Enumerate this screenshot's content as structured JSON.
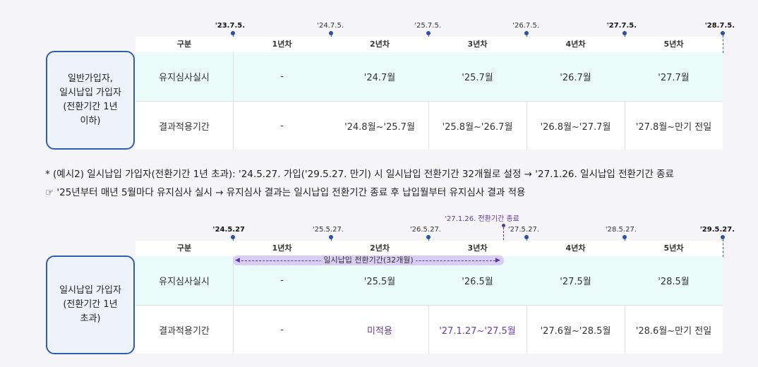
{
  "table1": {
    "group_label": "일반가입자,\n일시납입 가입자\n(전환기간 1년\n이하)",
    "dates": [
      "'23.7.5.",
      "'24.7.5.",
      "'25.7.5.",
      "'26.7.5.",
      "'27.7.5.",
      "'28.7.5."
    ],
    "headers": [
      "구분",
      "1년차",
      "2년차",
      "3년차",
      "4년차",
      "5년차"
    ],
    "row1": [
      "유지심사실시",
      "-",
      "'24.7월",
      "'25.7월",
      "'26.7월",
      "'27.7월"
    ],
    "row2": [
      "결과적용기간",
      "-",
      "'24.8월~'25.7월",
      "'25.8월~'26.7월",
      "'26.8월~'27.7월",
      "'27.8월~만기 전일"
    ]
  },
  "note": {
    "line1": "* (예시2) 일시납입 가입자(전환기간 1년 초과): '24.5.27. 가입('29.5.27. 만기) 시 일시납입 전환기간 32개월로 설정 → '27.1.26. 일시납입 전환기간 종료",
    "line2": "☞ '25년부터 매년 5월마다 유지심사 실시 → 유지심사 결과는 일시납입 전환기간 종료 후 납입월부터 유지심사 결과 적용"
  },
  "table2": {
    "group_label": "일시납입 가입자\n(전환기간 1년\n초과)",
    "dates": [
      "'24.5.27",
      "'25.5.27.",
      "'26.5.27.",
      "'27.5.27.",
      "'28.5.27.",
      "'29.5.27."
    ],
    "end_note": "'27.1.26. 전환기간 종료",
    "span_label": "일시납입 전환기간(32개월)",
    "headers": [
      "구분",
      "1년차",
      "2년차",
      "3년차",
      "4년차",
      "5년차"
    ],
    "row1": [
      "유지심사실시",
      "-",
      "'25.5월",
      "'26.5월",
      "'27.5월",
      "'28.5월"
    ],
    "row2": [
      "결과적용기간",
      "-",
      "미적용",
      "'27.1.27~'27.5월",
      "'27.6월~'28.5월",
      "'28.6월~만기 전일"
    ]
  }
}
